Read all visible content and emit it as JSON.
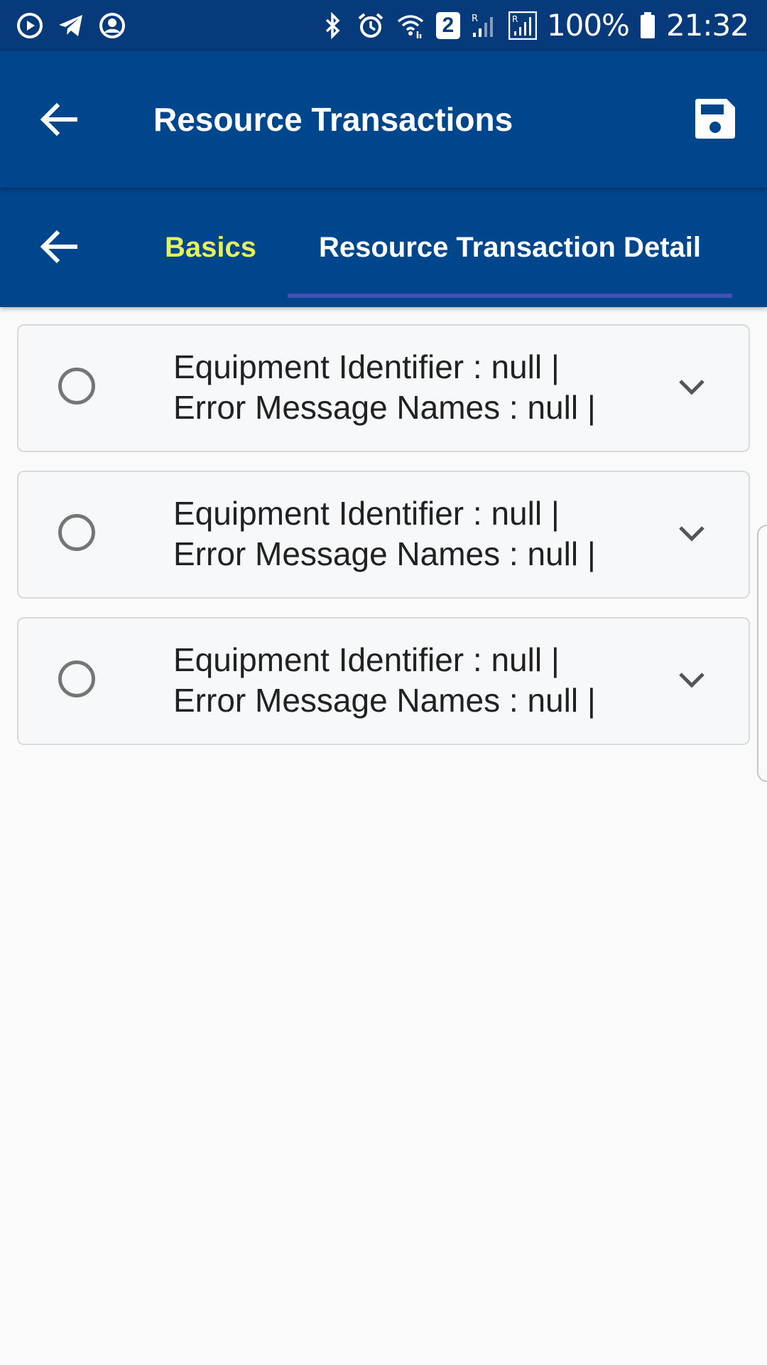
{
  "status_bar": {
    "battery_percent": "100%",
    "time": "21:32",
    "notification_badge": "2",
    "left_icons": [
      "play-circle-icon",
      "telegram-icon",
      "account-circle-icon"
    ],
    "right_icons": [
      "bluetooth-icon",
      "alarm-icon",
      "wifi-icon",
      "signal-icon",
      "signal-icon",
      "battery-icon"
    ]
  },
  "app_bar": {
    "title": "Resource Transactions",
    "back_icon": "arrow-left-icon",
    "save_icon": "save-floppy-icon"
  },
  "tabs": {
    "items": [
      {
        "label": "Basics",
        "selected": false
      },
      {
        "label": "Resource Transaction Detail",
        "selected": true
      }
    ]
  },
  "list": {
    "items": [
      {
        "line1": "Equipment Identifier : null |",
        "line2": "Error Message Names : null |"
      },
      {
        "line1": "Equipment Identifier : null |",
        "line2": "Error Message Names : null |"
      },
      {
        "line1": "Equipment Identifier : null |",
        "line2": "Error Message Names : null |"
      }
    ]
  },
  "colors": {
    "status_bar_bg": "#063a7a",
    "app_bar_bg": "#00468c",
    "tab_inactive_text": "#e6f25a",
    "tab_active_text": "#ffffff",
    "tab_indicator": "#3f51b5",
    "page_bg": "#fafafa"
  }
}
